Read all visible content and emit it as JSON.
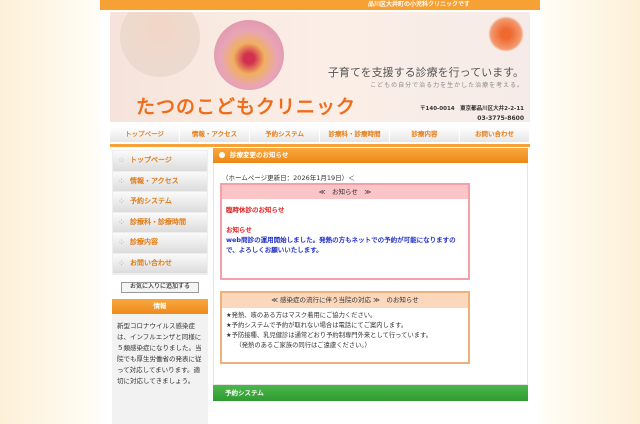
{
  "topbar": "品川区大井町の小児科クリニックです",
  "header": {
    "tagline": "子育てを支援する診療を行っています。",
    "subtagline": "こどもの自分で治る力を生かした治療を考える。",
    "logo": "たつのこどもクリニック",
    "address": "〒140-0014　東京都品川区大井2-2-11",
    "tel": "03-3775-8600"
  },
  "nav": [
    "トップページ",
    "情報・アクセス",
    "予約システム",
    "診療科・診療時間",
    "診療内容",
    "お問い合わせ"
  ],
  "sidebar": {
    "items": [
      "トップページ",
      "情報・アクセス",
      "予約システム",
      "診療科・診療時間",
      "診療内容",
      "お問い合わせ"
    ],
    "favorite_button": "お気に入りに追加する",
    "info_title": "情報",
    "info_text": "新型コロナウイルス感染症は、インフルエンザと同様に５類感染症になりました。当院でも厚生労働省の発表に従って対応してまいります。適切に対応してきましょう。"
  },
  "main": {
    "section_title": "診療変更のお知らせ",
    "updated": "（ホームページ更新日：2026年1月19日）＜",
    "notice": {
      "header": "≪　お知らせ　≫",
      "closure": "臨時休診のお知らせ",
      "label": "お知らせ",
      "body": "web問診の運用開始しました。発熱の方もネットでの予約が可能になりますので、よろしくお願いいたします。"
    },
    "infection": {
      "header": "≪ 感染症の流行に伴う当院の対応 ≫　のお知らせ",
      "lines": [
        "★発熱、咳のある方はマスク着用にご協力ください。",
        "★予約システムで予約が取れない場合は電話にてご案内します。",
        "★予防接種、乳児健診は通常どおり予約制専門外来として行っています。",
        "　　（発熱のあるご家族の同行はご遠慮ください。）"
      ]
    },
    "next_section": "予約システム"
  }
}
